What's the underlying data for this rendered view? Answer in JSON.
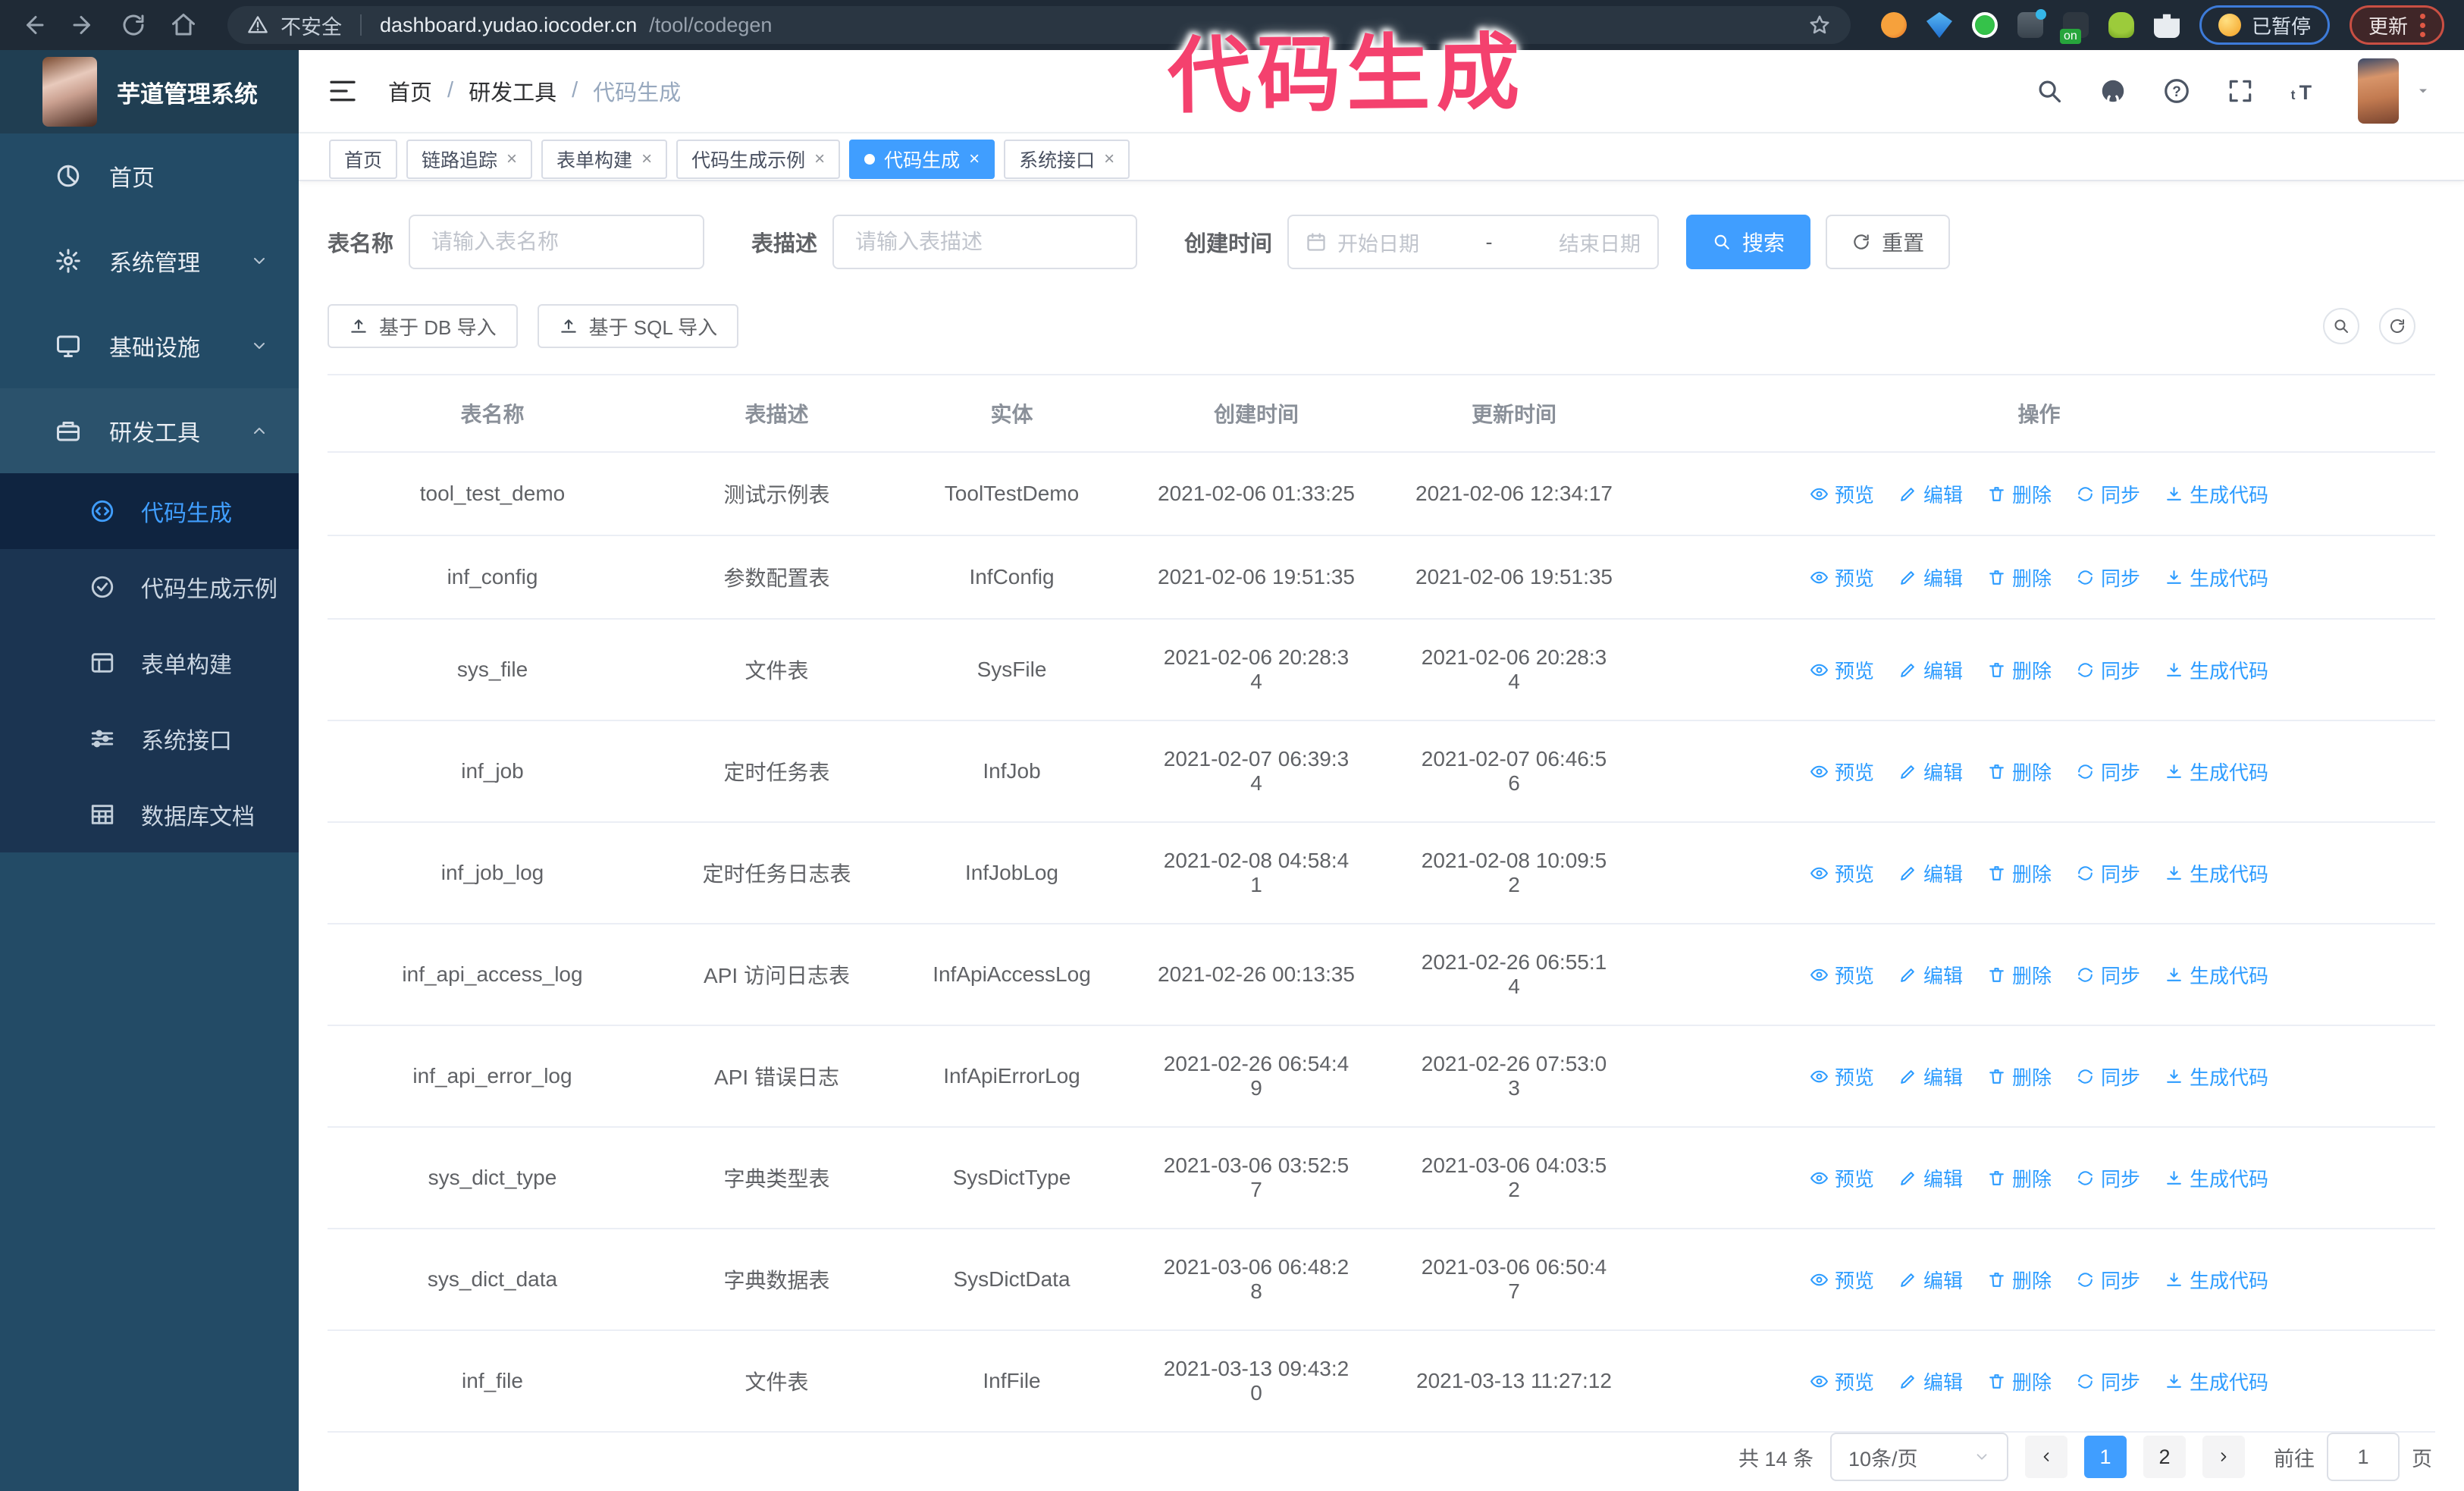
{
  "browser": {
    "security_label": "不安全",
    "url_host": "dashboard.yudao.iocoder.cn",
    "url_path": "/tool/codegen",
    "extension_on_badge": "on",
    "paused_badge": "已暂停",
    "update_badge": "更新"
  },
  "annotation": {
    "text": "代码生成",
    "color": "#F4416E"
  },
  "app": {
    "title": "芋道管理系统"
  },
  "breadcrumb": {
    "items": [
      "首页",
      "研发工具",
      "代码生成"
    ]
  },
  "sidebar": {
    "items": [
      {
        "label": "首页"
      },
      {
        "label": "系统管理"
      },
      {
        "label": "基础设施"
      },
      {
        "label": "研发工具"
      }
    ],
    "sub_items": [
      {
        "label": "代码生成"
      },
      {
        "label": "代码生成示例"
      },
      {
        "label": "表单构建"
      },
      {
        "label": "系统接口"
      },
      {
        "label": "数据库文档"
      }
    ]
  },
  "tabs": [
    {
      "label": "首页"
    },
    {
      "label": "链路追踪"
    },
    {
      "label": "表单构建"
    },
    {
      "label": "代码生成示例"
    },
    {
      "label": "代码生成"
    },
    {
      "label": "系统接口"
    }
  ],
  "filters": {
    "table_name_label": "表名称",
    "table_name_placeholder": "请输入表名称",
    "table_desc_label": "表描述",
    "table_desc_placeholder": "请输入表描述",
    "create_time_label": "创建时间",
    "date_start_placeholder": "开始日期",
    "date_separator": "-",
    "date_end_placeholder": "结束日期",
    "search_label": "搜索",
    "reset_label": "重置"
  },
  "toolbar": {
    "import_db_label": "基于 DB 导入",
    "import_sql_label": "基于 SQL 导入"
  },
  "table": {
    "columns": [
      "表名称",
      "表描述",
      "实体",
      "创建时间",
      "更新时间",
      "操作"
    ],
    "actions": [
      "预览",
      "编辑",
      "删除",
      "同步",
      "生成代码"
    ],
    "rows": [
      {
        "name": "tool_test_demo",
        "desc": "测试示例表",
        "entity": "ToolTestDemo",
        "created": "2021-02-06 01:33:25",
        "updated": "2021-02-06 12:34:17"
      },
      {
        "name": "inf_config",
        "desc": "参数配置表",
        "entity": "InfConfig",
        "created": "2021-02-06 19:51:35",
        "updated": "2021-02-06 19:51:35"
      },
      {
        "name": "sys_file",
        "desc": "文件表",
        "entity": "SysFile",
        "created": "2021-02-06 20:28:3\n4",
        "updated": "2021-02-06 20:28:3\n4"
      },
      {
        "name": "inf_job",
        "desc": "定时任务表",
        "entity": "InfJob",
        "created": "2021-02-07 06:39:3\n4",
        "updated": "2021-02-07 06:46:5\n6"
      },
      {
        "name": "inf_job_log",
        "desc": "定时任务日志表",
        "entity": "InfJobLog",
        "created": "2021-02-08 04:58:4\n1",
        "updated": "2021-02-08 10:09:5\n2"
      },
      {
        "name": "inf_api_access_log",
        "desc": "API 访问日志表",
        "entity": "InfApiAccessLog",
        "created": "2021-02-26 00:13:35",
        "updated": "2021-02-26 06:55:1\n4"
      },
      {
        "name": "inf_api_error_log",
        "desc": "API 错误日志",
        "entity": "InfApiErrorLog",
        "created": "2021-02-26 06:54:4\n9",
        "updated": "2021-02-26 07:53:0\n3"
      },
      {
        "name": "sys_dict_type",
        "desc": "字典类型表",
        "entity": "SysDictType",
        "created": "2021-03-06 03:52:5\n7",
        "updated": "2021-03-06 04:03:5\n2"
      },
      {
        "name": "sys_dict_data",
        "desc": "字典数据表",
        "entity": "SysDictData",
        "created": "2021-03-06 06:48:2\n8",
        "updated": "2021-03-06 06:50:4\n7"
      },
      {
        "name": "inf_file",
        "desc": "文件表",
        "entity": "InfFile",
        "created": "2021-03-13 09:43:2\n0",
        "updated": "2021-03-13 11:27:12"
      }
    ]
  },
  "pagination": {
    "total_text": "共 14 条",
    "page_size": "10条/页",
    "page_1": "1",
    "page_2": "2",
    "goto_label": "前往",
    "goto_value": "1",
    "page_unit": "页"
  },
  "colors": {
    "accent": "#409EFF",
    "sidebar_bg": "#234B66",
    "submenu_bg": "#1B3451"
  }
}
